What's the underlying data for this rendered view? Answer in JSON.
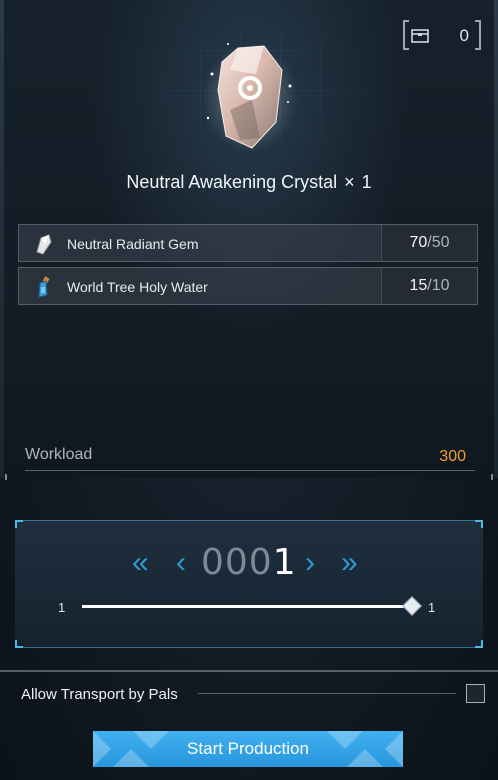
{
  "inventory": {
    "icon": "chest-icon",
    "count": "0"
  },
  "item": {
    "name": "Neutral Awakening Crystal",
    "times": "×",
    "quantity": "1",
    "icon": "crystal-icon"
  },
  "materials": [
    {
      "name": "Neutral Radiant Gem",
      "have": "70",
      "required": "50",
      "icon": "gem-icon"
    },
    {
      "name": "World Tree Holy Water",
      "have": "15",
      "required": "10",
      "icon": "potion-icon"
    }
  ],
  "workload": {
    "label": "Workload",
    "value": "300"
  },
  "quantity_selector": {
    "zeros": "000",
    "digit": "1",
    "slider_min": "1",
    "slider_max": "1",
    "slider_value_fraction": 1.0
  },
  "transport": {
    "label": "Allow Transport by Pals",
    "checked": false
  },
  "start_button": {
    "label": "Start Production"
  },
  "colors": {
    "accent": "#2f9bd0",
    "workload": "#f0a030",
    "button": "#3fb0f0"
  }
}
